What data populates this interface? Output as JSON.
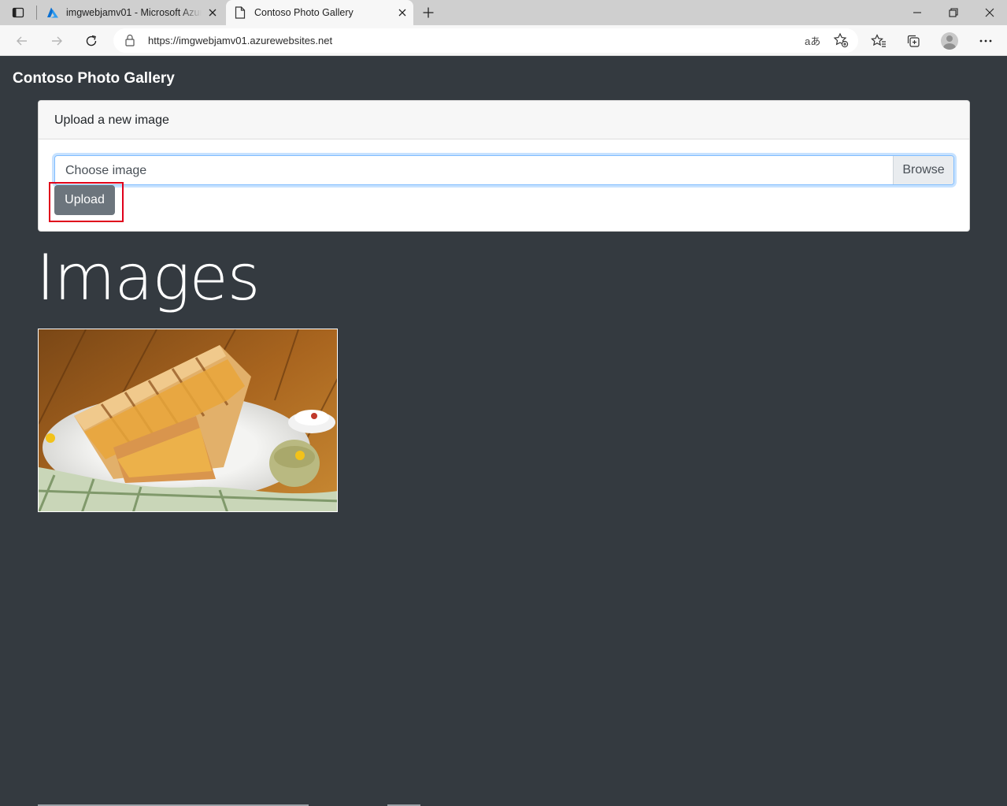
{
  "browser": {
    "tabs": [
      {
        "title": "imgwebjamv01 - Microsoft Azure",
        "active": false,
        "favicon": "azure-logo-icon"
      },
      {
        "title": "Contoso Photo Gallery",
        "active": true,
        "favicon": "page-icon"
      }
    ],
    "url": "https://imgwebjamv01.azurewebsites.net",
    "read_aloud_glyph": "aあ"
  },
  "page": {
    "brand": "Contoso Photo Gallery",
    "upload_card": {
      "header": "Upload a new image",
      "file_placeholder": "Choose image",
      "browse_label": "Browse",
      "upload_label": "Upload"
    },
    "images_heading": "Images",
    "images": [
      {
        "alt": "Grilled cheese sandwich on a plate with dips"
      }
    ]
  },
  "colors": {
    "page_bg": "#343a40",
    "upload_button": "#6c757d",
    "highlight": "#e0001b",
    "focus_border": "#80bdff"
  }
}
